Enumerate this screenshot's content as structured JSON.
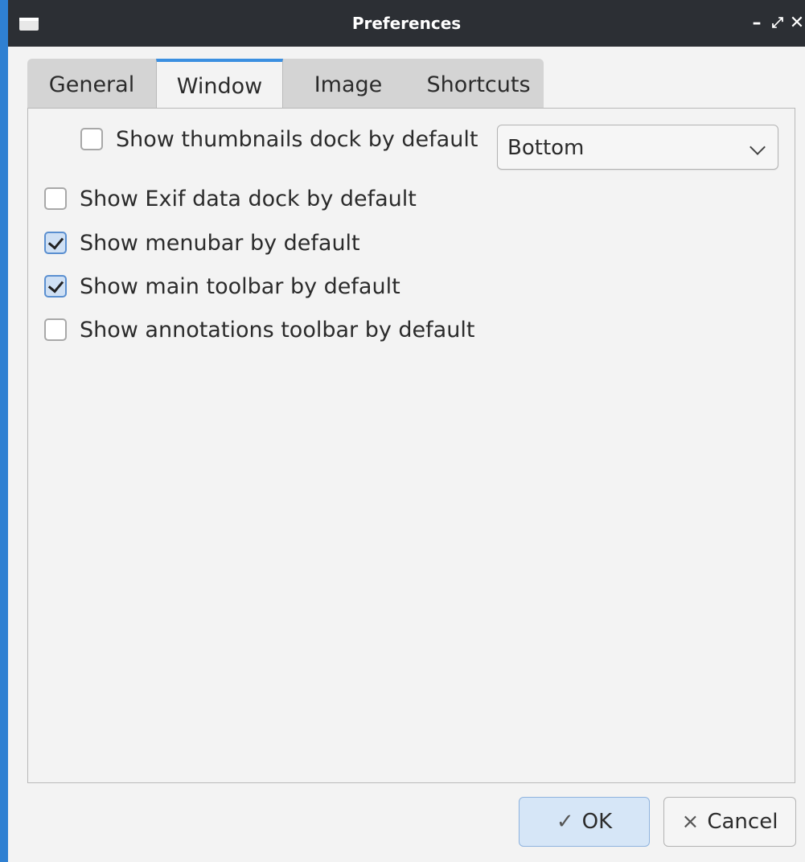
{
  "window": {
    "title": "Preferences",
    "controls": {
      "minimize": "–",
      "maximize": "⤢",
      "close": "✕"
    }
  },
  "tabs": [
    {
      "label": "General",
      "active": false
    },
    {
      "label": "Window",
      "active": true
    },
    {
      "label": "Image",
      "active": false
    },
    {
      "label": "Shortcuts",
      "active": false
    }
  ],
  "options": {
    "thumbnails": {
      "label": "Show thumbnails dock by default",
      "checked": false
    },
    "thumbnails_position": {
      "value": "Bottom"
    },
    "exif": {
      "label": "Show Exif data dock by default",
      "checked": false
    },
    "menubar": {
      "label": "Show menubar by default",
      "checked": true
    },
    "main_toolbar": {
      "label": "Show main toolbar by default",
      "checked": true
    },
    "annotations_toolbar": {
      "label": "Show annotations toolbar by default",
      "checked": false
    }
  },
  "buttons": {
    "ok": {
      "label": "OK",
      "glyph": "✓"
    },
    "cancel": {
      "label": "Cancel",
      "glyph": "×"
    }
  },
  "colors": {
    "accent": "#3b8fe0",
    "titlebar": "#2c2f34",
    "ok_button": "#d6e6f7"
  }
}
